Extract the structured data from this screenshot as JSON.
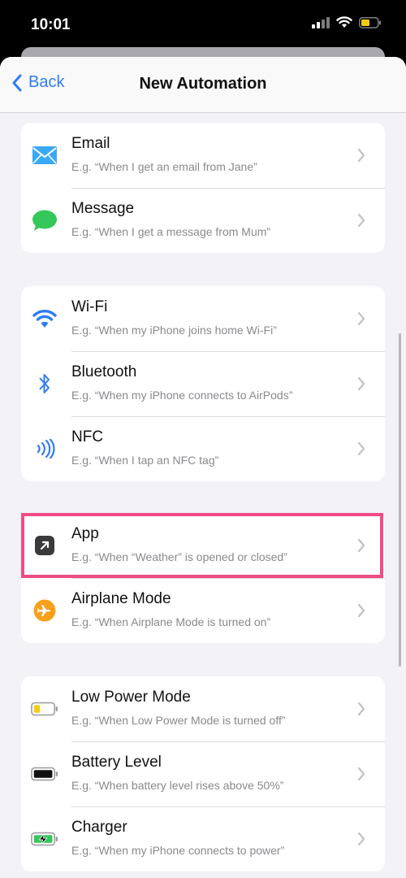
{
  "status": {
    "time": "10:01"
  },
  "nav": {
    "back_label": "Back",
    "title": "New Automation"
  },
  "groups": [
    {
      "items": [
        {
          "title": "Email",
          "subtitle": "E.g. “When I get an email from Jane”",
          "icon": "mail-icon"
        },
        {
          "title": "Message",
          "subtitle": "E.g. “When I get a message from Mum”",
          "icon": "message-icon"
        }
      ]
    },
    {
      "items": [
        {
          "title": "Wi-Fi",
          "subtitle": "E.g. “When my iPhone joins home Wi-Fi”",
          "icon": "wifi-icon"
        },
        {
          "title": "Bluetooth",
          "subtitle": "E.g. “When my iPhone connects to AirPods”",
          "icon": "bluetooth-icon"
        },
        {
          "title": "NFC",
          "subtitle": "E.g. “When I tap an NFC tag”",
          "icon": "nfc-icon"
        }
      ]
    },
    {
      "items": [
        {
          "title": "App",
          "subtitle": "E.g. “When “Weather” is opened or closed”",
          "icon": "app-icon"
        },
        {
          "title": "Airplane Mode",
          "subtitle": "E.g. “When Airplane Mode is turned on”",
          "icon": "airplane-icon"
        }
      ]
    },
    {
      "items": [
        {
          "title": "Low Power Mode",
          "subtitle": "E.g. “When Low Power Mode is turned off”",
          "icon": "low-power-battery-icon"
        },
        {
          "title": "Battery Level",
          "subtitle": "E.g. “When battery level rises above 50%”",
          "icon": "battery-level-icon"
        },
        {
          "title": "Charger",
          "subtitle": "E.g. “When my iPhone connects to power”",
          "icon": "charger-icon"
        }
      ]
    }
  ],
  "colors": {
    "accent": "#2f7cf6",
    "highlight": "#f14b86",
    "airplane": "#f7a01b",
    "message": "#34c759",
    "mail": "#3aa9f5"
  }
}
